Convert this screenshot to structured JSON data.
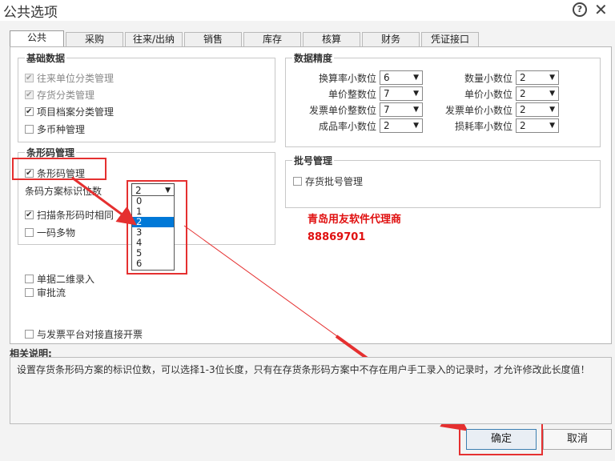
{
  "window": {
    "title": "公共选项",
    "help_icon": "question-circle-icon",
    "close_icon": "close-x-icon"
  },
  "tabs": [
    "公共",
    "采购",
    "往来/出纳",
    "销售",
    "库存",
    "核算",
    "财务",
    "凭证接口"
  ],
  "basic_data": {
    "title": "基础数据",
    "items": [
      {
        "label": "往来单位分类管理",
        "checked": true,
        "disabled": true
      },
      {
        "label": "存货分类管理",
        "checked": true,
        "disabled": true
      },
      {
        "label": "项目档案分类管理",
        "checked": true,
        "disabled": false
      },
      {
        "label": "多币种管理",
        "checked": false,
        "disabled": false
      }
    ]
  },
  "precision": {
    "title": "数据精度",
    "left": [
      {
        "label": "换算率小数位",
        "value": "6"
      },
      {
        "label": "单价整数位",
        "value": "7"
      },
      {
        "label": "发票单价整数位",
        "value": "7"
      },
      {
        "label": "成品率小数位",
        "value": "2"
      }
    ],
    "right": [
      {
        "label": "数量小数位",
        "value": "2"
      },
      {
        "label": "单价小数位",
        "value": "2"
      },
      {
        "label": "发票单价小数位",
        "value": "2"
      },
      {
        "label": "损耗率小数位",
        "value": "2"
      }
    ]
  },
  "barcode": {
    "title": "条形码管理",
    "manage_label": "条形码管理",
    "scheme_label": "条码方案标识位数",
    "scheme_value": "2",
    "scheme_options": [
      "0",
      "1",
      "2",
      "3",
      "4",
      "5",
      "6"
    ],
    "scheme_selected": "2",
    "scan_label": "扫描条形码时相同",
    "one_code_label": "一码多物"
  },
  "batch": {
    "title": "批号管理",
    "item": "存货批号管理"
  },
  "extra": {
    "dual_unit": "单据二维录入",
    "approval": "审批流",
    "invoice_platform": "与发票平台对接直接开票"
  },
  "watermark": {
    "line1": "青岛用友软件代理商",
    "line2": "88869701"
  },
  "description": {
    "label": "相关说明:",
    "text": "设置存货条形码方案的标识位数，可以选择1-3位长度，只有在存货条形码方案中不存在用户手工录入的记录时，才允许修改此长度值！"
  },
  "buttons": {
    "ok": "确定",
    "cancel": "取消"
  },
  "colors": {
    "annotation_red": "#e53030",
    "selection_blue": "#0078d7"
  }
}
